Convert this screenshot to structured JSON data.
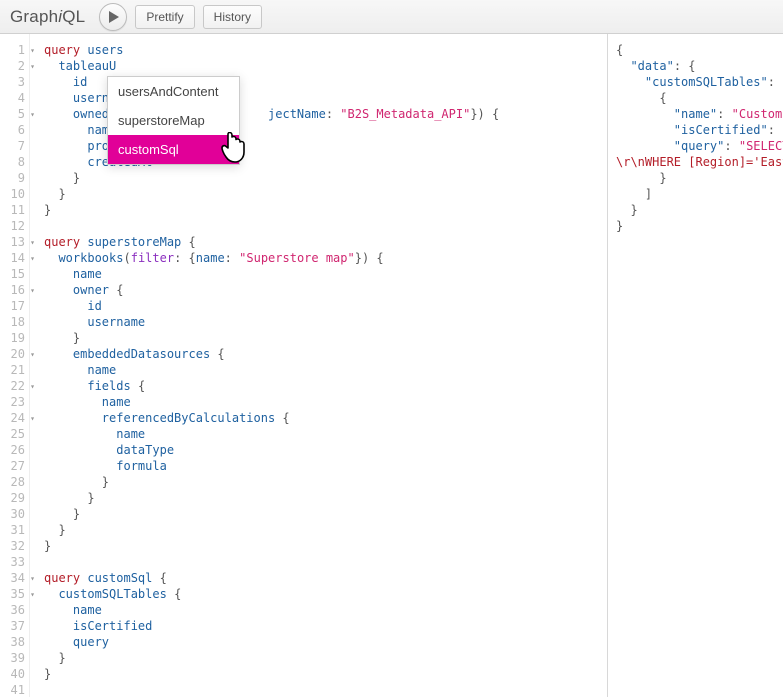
{
  "logo": {
    "pre": "Graph",
    "i": "i",
    "post": "QL"
  },
  "toolbar": {
    "prettify": "Prettify",
    "history": "History"
  },
  "dropdown": {
    "items": [
      "usersAndContent",
      "superstoreMap",
      "customSql"
    ],
    "selectedIndex": 2
  },
  "lines": [
    {
      "n": 1,
      "fold": true,
      "html": "<span class='kw'>query</span> <span class='def'>users</span>"
    },
    {
      "n": 2,
      "fold": true,
      "html": "  <span class='field'>tableauU</span>"
    },
    {
      "n": 3,
      "html": "    <span class='field'>id</span>"
    },
    {
      "n": 4,
      "html": "    <span class='field'>usernam</span>"
    },
    {
      "n": 5,
      "fold": true,
      "html": "    <span class='field'>ownedWorkbooks</span><span class='punc'>(</span><span class='arg'>filter</span><span class='punc'>:</span>     <span class='argname'>jectName</span><span class='punc'>:</span> <span class='str'>\"B2S_Metadata_API\"</span><span class='punc'>}) {</span>"
    },
    {
      "n": 6,
      "html": "      <span class='field'>name</span>"
    },
    {
      "n": 7,
      "html": "      <span class='field'>projectName</span>"
    },
    {
      "n": 8,
      "html": "      <span class='field'>createdAt</span>"
    },
    {
      "n": 9,
      "html": "    <span class='punc'>}</span>"
    },
    {
      "n": 10,
      "html": "  <span class='punc'>}</span>"
    },
    {
      "n": 11,
      "html": "<span class='punc'>}</span>"
    },
    {
      "n": 12,
      "html": ""
    },
    {
      "n": 13,
      "fold": true,
      "html": "<span class='kw'>query</span> <span class='def'>superstoreMap</span> <span class='punc'>{</span>"
    },
    {
      "n": 14,
      "fold": true,
      "html": "  <span class='field'>workbooks</span><span class='punc'>(</span><span class='arg'>filter</span><span class='punc'>: {</span><span class='argname'>name</span><span class='punc'>:</span> <span class='str'>\"Superstore map\"</span><span class='punc'>}) {</span>"
    },
    {
      "n": 15,
      "html": "    <span class='field'>name</span>"
    },
    {
      "n": 16,
      "fold": true,
      "html": "    <span class='field'>owner</span> <span class='punc'>{</span>"
    },
    {
      "n": 17,
      "html": "      <span class='field'>id</span>"
    },
    {
      "n": 18,
      "html": "      <span class='field'>username</span>"
    },
    {
      "n": 19,
      "html": "    <span class='punc'>}</span>"
    },
    {
      "n": 20,
      "fold": true,
      "html": "    <span class='field'>embeddedDatasources</span> <span class='punc'>{</span>"
    },
    {
      "n": 21,
      "html": "      <span class='field'>name</span>"
    },
    {
      "n": 22,
      "fold": true,
      "html": "      <span class='field'>fields</span> <span class='punc'>{</span>"
    },
    {
      "n": 23,
      "html": "        <span class='field'>name</span>"
    },
    {
      "n": 24,
      "fold": true,
      "html": "        <span class='field'>referencedByCalculations</span> <span class='punc'>{</span>"
    },
    {
      "n": 25,
      "html": "          <span class='field'>name</span>"
    },
    {
      "n": 26,
      "html": "          <span class='field'>dataType</span>"
    },
    {
      "n": 27,
      "html": "          <span class='field'>formula</span>"
    },
    {
      "n": 28,
      "html": "        <span class='punc'>}</span>"
    },
    {
      "n": 29,
      "html": "      <span class='punc'>}</span>"
    },
    {
      "n": 30,
      "html": "    <span class='punc'>}</span>"
    },
    {
      "n": 31,
      "html": "  <span class='punc'>}</span>"
    },
    {
      "n": 32,
      "html": "<span class='punc'>}</span>"
    },
    {
      "n": 33,
      "html": ""
    },
    {
      "n": 34,
      "fold": true,
      "html": "<span class='kw'>query</span> <span class='def'>customSql</span> <span class='punc'>{</span>"
    },
    {
      "n": 35,
      "fold": true,
      "html": "  <span class='field'>customSQLTables</span> <span class='punc'>{</span>"
    },
    {
      "n": 36,
      "html": "    <span class='field'>name</span>"
    },
    {
      "n": 37,
      "html": "    <span class='field'>isCertified</span>"
    },
    {
      "n": 38,
      "html": "    <span class='field'>query</span>"
    },
    {
      "n": 39,
      "html": "  <span class='punc'>}</span>"
    },
    {
      "n": 40,
      "html": "<span class='punc'>}</span>"
    },
    {
      "n": 41,
      "html": ""
    }
  ],
  "results": [
    "<span class='rpunc'>{</span>",
    "  <span class='rkey'>\"data\"</span><span class='rpunc'>: {</span>",
    "    <span class='rkey'>\"customSQLTables\"</span><span class='rpunc'>: [</span>",
    "      <span class='rpunc'>{</span>",
    "        <span class='rkey'>\"name\"</span><span class='rpunc'>:</span> <span class='rstr'>\"Custom S</span>",
    "        <span class='rkey'>\"isCertified\"</span><span class='rpunc'>:</span> <span class='rnull'>nu</span>",
    "        <span class='rkey'>\"query\"</span><span class='rpunc'>:</span> <span class='rstr'>\"SELECT </span>",
    "<span class='rred'>\\r\\nWHERE [Region]='East'</span>",
    "      <span class='rpunc'>}</span>",
    "    <span class='rpunc'>]</span>",
    "  <span class='rpunc'>}</span>",
    "<span class='rpunc'>}</span>"
  ]
}
